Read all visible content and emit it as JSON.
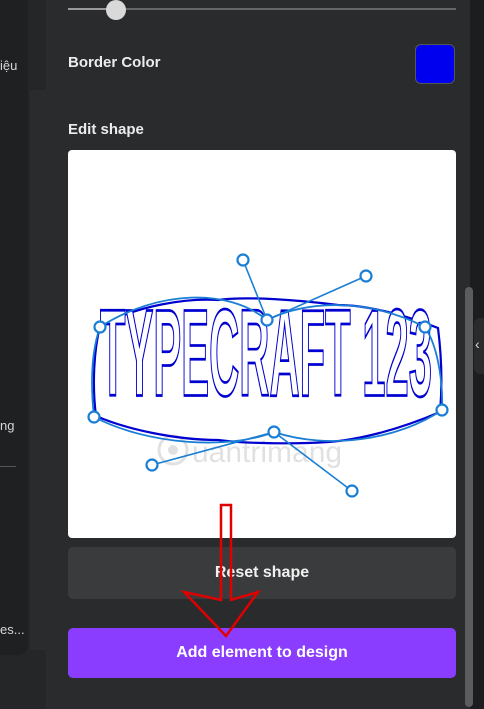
{
  "left_sidebar": {
    "label_1": "iệu",
    "label_2": "ng",
    "label_3": "es..."
  },
  "panel": {
    "border_color_label": "Border Color",
    "border_color_value": "#0000ee",
    "edit_shape_label": "Edit shape",
    "shape_text": "TYPECRAFT 123",
    "watermark": "uantrimang",
    "reset_button": "Reset shape",
    "add_button": "Add element to design"
  },
  "colors": {
    "accent": "#8b3dff",
    "outline": "#1a7fd4",
    "shape_stroke": "#0000d0",
    "arrow": "#e00000"
  }
}
